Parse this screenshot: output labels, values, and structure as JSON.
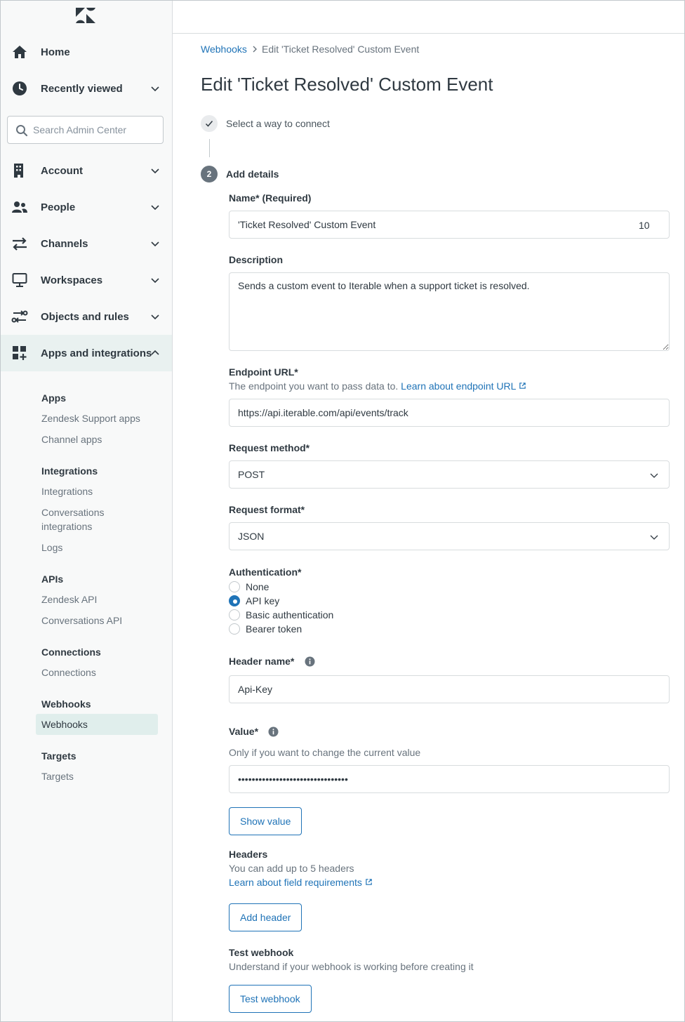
{
  "sidebar": {
    "search": {
      "placeholder": "Search Admin Center"
    },
    "nav": [
      {
        "label": "Home",
        "icon": "home-icon"
      },
      {
        "label": "Recently viewed",
        "icon": "clock-icon"
      },
      {
        "label": "Account",
        "icon": "building-icon"
      },
      {
        "label": "People",
        "icon": "people-icon"
      },
      {
        "label": "Channels",
        "icon": "arrows-icon"
      },
      {
        "label": "Workspaces",
        "icon": "monitor-icon"
      },
      {
        "label": "Objects and rules",
        "icon": "rules-icon"
      },
      {
        "label": "Apps and integrations",
        "icon": "apps-icon"
      }
    ],
    "sections": {
      "apps": {
        "heading": "Apps",
        "links": [
          "Zendesk Support apps",
          "Channel apps"
        ]
      },
      "integrations": {
        "heading": "Integrations",
        "links": [
          "Integrations",
          "Conversations integrations",
          "Logs"
        ]
      },
      "apis": {
        "heading": "APIs",
        "links": [
          "Zendesk API",
          "Conversations API"
        ]
      },
      "connections": {
        "heading": "Connections",
        "links": [
          "Connections"
        ]
      },
      "webhooks": {
        "heading": "Webhooks",
        "links": [
          "Webhooks"
        ]
      },
      "targets": {
        "heading": "Targets",
        "links": [
          "Targets"
        ]
      }
    }
  },
  "breadcrumb": {
    "parent": "Webhooks",
    "current": "Edit 'Ticket Resolved' Custom Event"
  },
  "page": {
    "title": "Edit 'Ticket Resolved' Custom Event"
  },
  "steps": {
    "step1": {
      "label": "Select a way to connect"
    },
    "step2": {
      "number": "2",
      "label": "Add details"
    }
  },
  "form": {
    "name": {
      "label": "Name* (Required)",
      "value": "'Ticket Resolved' Custom Event",
      "count": "10"
    },
    "description": {
      "label": "Description",
      "value": "Sends a custom event to Iterable when a support ticket is resolved."
    },
    "endpoint": {
      "label": "Endpoint URL*",
      "hint": "The endpoint you want to pass data to.",
      "link": "Learn about endpoint URL",
      "value": "https://api.iterable.com/api/events/track"
    },
    "method": {
      "label": "Request method*",
      "value": "POST"
    },
    "format": {
      "label": "Request format*",
      "value": "JSON"
    },
    "auth": {
      "label": "Authentication*",
      "options": [
        "None",
        "API key",
        "Basic authentication",
        "Bearer token"
      ],
      "selected": "API key"
    },
    "header_name": {
      "label": "Header name*",
      "value": "Api-Key"
    },
    "value": {
      "label": "Value*",
      "hint": "Only if you want to change the current value",
      "masked": "••••••••••••••••••••••••••••••••",
      "button": "Show value"
    },
    "headers": {
      "label": "Headers",
      "hint": "You can add up to 5 headers",
      "link": "Learn about field requirements",
      "button": "Add header"
    },
    "test": {
      "label": "Test webhook",
      "hint": "Understand if your webhook is working before creating it",
      "button": "Test webhook"
    }
  },
  "colors": {
    "accent": "#1f73b7",
    "text": "#2f3941",
    "muted": "#68737d",
    "active_bg": "#e9f1f0"
  }
}
